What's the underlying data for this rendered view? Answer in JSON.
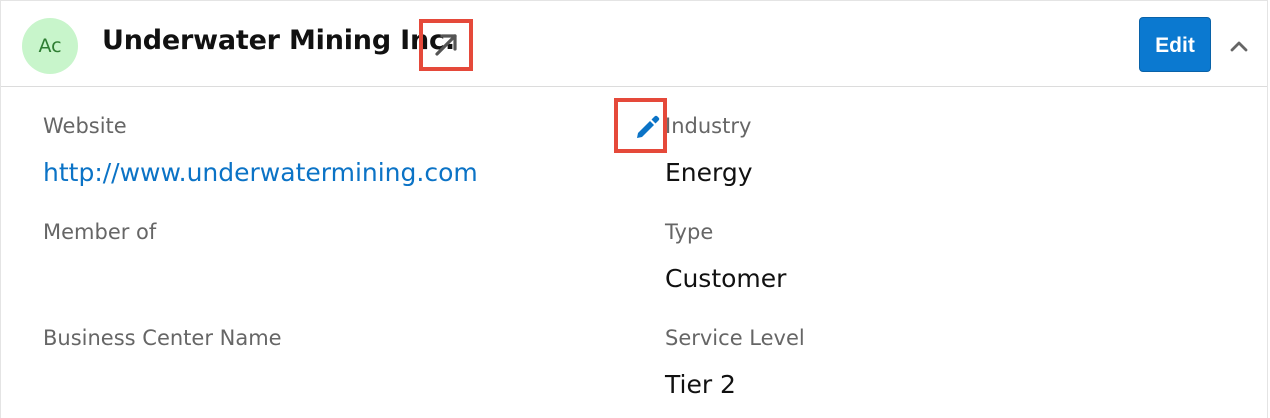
{
  "header": {
    "avatar_initials": "Ac",
    "title": "Underwater Mining Inc.",
    "edit_label": "Edit",
    "icons": {
      "open_link": "external-link-arrow-icon",
      "collapse": "chevron-up-icon"
    }
  },
  "fields": {
    "website": {
      "label": "Website",
      "value": "http://www.underwatermining.com"
    },
    "industry": {
      "label": "Industry",
      "value": "Energy",
      "edit_icon": "pencil-icon"
    },
    "member_of": {
      "label": "Member of",
      "value": ""
    },
    "type": {
      "label": "Type",
      "value": "Customer"
    },
    "business_center_name": {
      "label": "Business Center Name",
      "value": ""
    },
    "service_level": {
      "label": "Service Level",
      "value": "Tier 2"
    }
  },
  "colors": {
    "accent": "#0b79d0",
    "link": "#0b73c6",
    "highlight": "#e5493a",
    "avatar_bg": "#c8f5cb"
  }
}
